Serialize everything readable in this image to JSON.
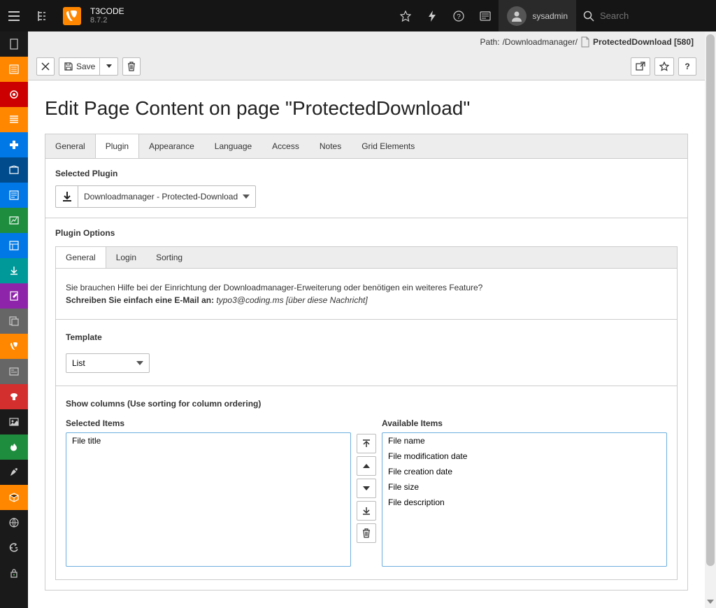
{
  "brand": {
    "name": "T3CODE",
    "version": "8.7.2"
  },
  "user": {
    "name": "sysadmin"
  },
  "search": {
    "placeholder": "Search"
  },
  "path": {
    "label": "Path:",
    "value": "/Downloadmanager/",
    "page": "ProtectedDownload [580]"
  },
  "docheader": {
    "save": "Save"
  },
  "page_title": "Edit Page Content on page \"ProtectedDownload\"",
  "tabs": [
    "General",
    "Plugin",
    "Appearance",
    "Language",
    "Access",
    "Notes",
    "Grid Elements"
  ],
  "active_tab": 1,
  "sections": {
    "selected_plugin_label": "Selected Plugin",
    "plugin_options_label": "Plugin Options"
  },
  "plugin": {
    "selected": "Downloadmanager - Protected-Download"
  },
  "subtabs": [
    "General",
    "Login",
    "Sorting"
  ],
  "active_subtab": 0,
  "help": {
    "line1": "Sie brauchen Hilfe bei der Einrichtung der Downloadmanager-Erweiterung oder benötigen ein weiteres Feature?",
    "line2_bold": "Schreiben Sie einfach eine E-Mail an:",
    "line2_italic": "typo3@coding.ms [über diese Nachricht]"
  },
  "template": {
    "label": "Template",
    "selected": "List"
  },
  "columns": {
    "heading": "Show columns (Use sorting for column ordering)",
    "selected_label": "Selected Items",
    "available_label": "Available Items",
    "selected": [
      "File title"
    ],
    "available": [
      "File name",
      "File modification date",
      "File creation date",
      "File size",
      "File description"
    ]
  }
}
